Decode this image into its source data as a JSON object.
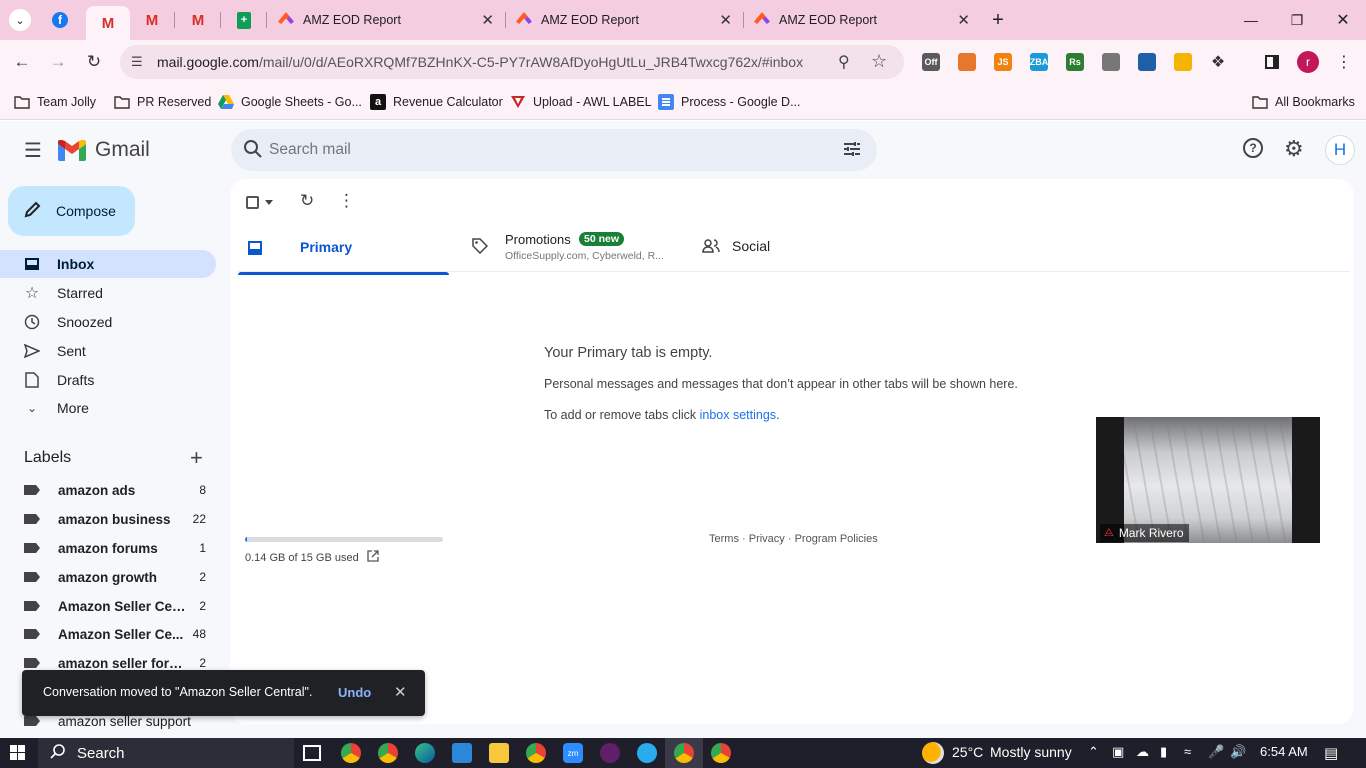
{
  "browser": {
    "tabs": [
      {
        "title": "AMZ EOD Report"
      },
      {
        "title": "AMZ EOD Report"
      },
      {
        "title": "AMZ EOD Report"
      }
    ],
    "url_host": "mail.google.com",
    "url_path": "/mail/u/0/d/AEoRXRQMf7BZHnKX-C5-PY7rAW8AfDyoHgUtLu_JRB4Twxcg762x/#inbox",
    "profile_initial": "r",
    "extensions": [
      {
        "icon": "off-extension-icon",
        "text": "Off",
        "color": "#5a5a5a"
      },
      {
        "icon": "firefox-like-extension-icon",
        "text": "",
        "color": "#e8772e"
      },
      {
        "icon": "js-extension-icon",
        "text": "JS",
        "color": "#f0820f"
      },
      {
        "icon": "zba-extension-icon",
        "text": "ZBA",
        "color": "#1a9bd7"
      },
      {
        "icon": "rs-extension-icon",
        "text": "Rs",
        "color": "#2d7d32"
      },
      {
        "icon": "plane-extension-icon",
        "text": "",
        "color": "#777777"
      },
      {
        "icon": "helium-extension-icon",
        "text": "",
        "color": "#1f5fa8"
      },
      {
        "icon": "scout-extension-icon",
        "text": "",
        "color": "#f5b400"
      }
    ],
    "bookmarks": [
      {
        "label": "Team Jolly",
        "icon": "folder-icon"
      },
      {
        "label": "PR Reserved",
        "icon": "folder-icon"
      },
      {
        "label": "Google Sheets - Go...",
        "icon": "google-drive-icon"
      },
      {
        "label": "Revenue Calculator",
        "icon": "amazon-icon"
      },
      {
        "label": "Upload - AWL LABEL",
        "icon": "awl-icon"
      },
      {
        "label": "Process - Google D...",
        "icon": "google-docs-icon"
      }
    ],
    "all_bookmarks": "All Bookmarks"
  },
  "gmail": {
    "logo_text": "Gmail",
    "search_placeholder": "Search mail",
    "account_initial": "H",
    "compose": "Compose",
    "nav": [
      {
        "label": "Inbox",
        "icon": "inbox-icon",
        "selected": true
      },
      {
        "label": "Starred",
        "icon": "star-icon"
      },
      {
        "label": "Snoozed",
        "icon": "clock-icon"
      },
      {
        "label": "Sent",
        "icon": "send-icon"
      },
      {
        "label": "Drafts",
        "icon": "draft-icon"
      },
      {
        "label": "More",
        "icon": "chevron-down-icon"
      }
    ],
    "labels_heading": "Labels",
    "labels": [
      {
        "name": "amazon ads",
        "count": "8"
      },
      {
        "name": "amazon business",
        "count": "22"
      },
      {
        "name": "amazon forums",
        "count": "1"
      },
      {
        "name": "amazon growth",
        "count": "2"
      },
      {
        "name": "Amazon Seller Cen...",
        "count": "2"
      },
      {
        "name": "Amazon Seller Ce...",
        "count": "48"
      },
      {
        "name": "amazon seller foru...",
        "count": "2"
      },
      {
        "name": "amazon seller support",
        "count": ""
      }
    ],
    "tabs": {
      "primary": "Primary",
      "promotions": "Promotions",
      "promotions_badge": "50 new",
      "promotions_senders": "OfficeSupply.com, Cyberweld, R...",
      "social": "Social"
    },
    "empty": {
      "title": "Your Primary tab is empty.",
      "line1": "Personal messages and messages that don’t appear in other tabs will be shown here.",
      "line2_prefix": "To add or remove tabs click ",
      "line2_link": "inbox settings",
      "line2_suffix": "."
    },
    "storage": {
      "text": "0.14 GB of 15 GB used",
      "used_fraction": 0.0093
    },
    "footer": {
      "terms": "Terms",
      "privacy": "Privacy",
      "policies": "Program Policies",
      "sep": " · "
    },
    "snackbar": {
      "message": "Conversation moved to \"Amazon Seller Central\".",
      "undo": "Undo"
    },
    "video_tile": {
      "name": "Mark Rivero"
    }
  },
  "taskbar": {
    "search": "Search",
    "weather_temp": "25°C",
    "weather_text": "Mostly sunny",
    "time": "6:54 AM"
  }
}
